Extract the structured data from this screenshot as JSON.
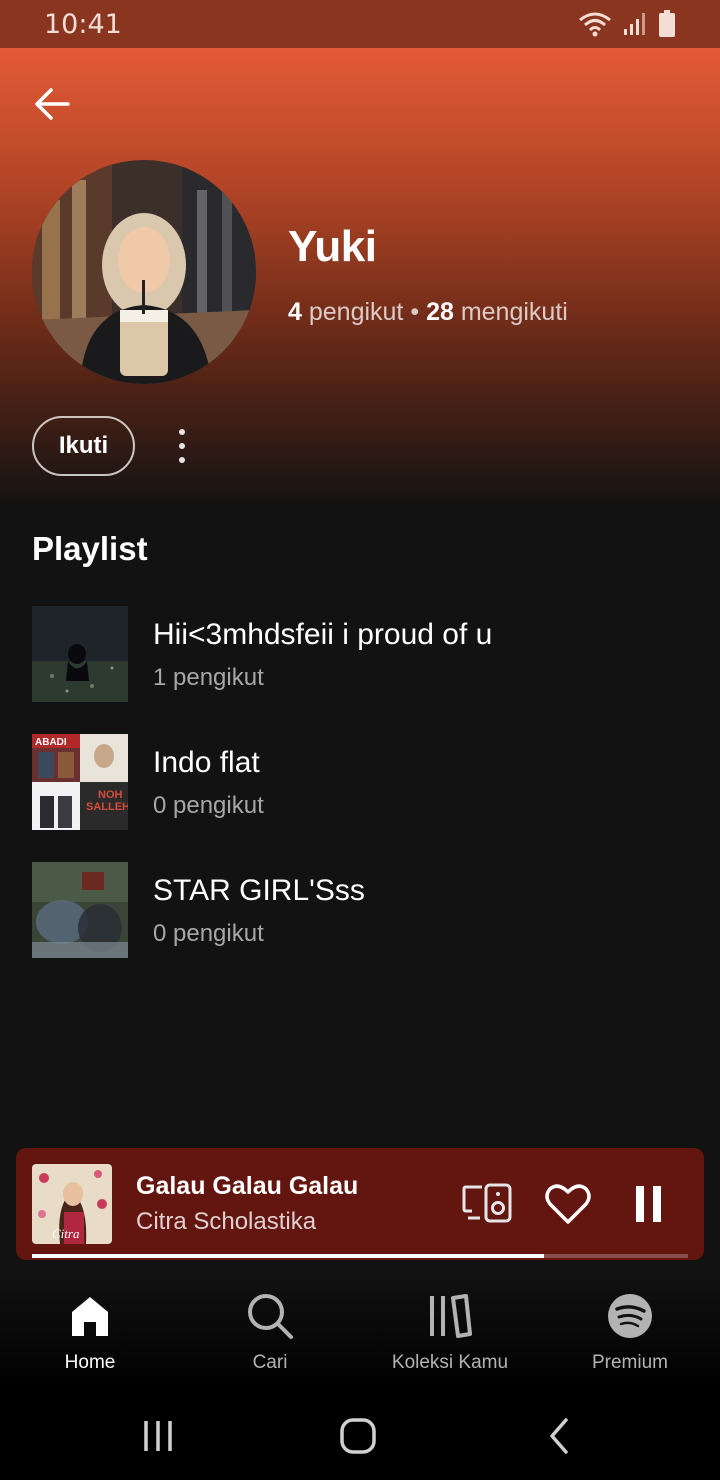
{
  "status_bar": {
    "time": "10:41"
  },
  "profile": {
    "name": "Yuki",
    "followers_count": "4",
    "followers_label": "pengikut",
    "separator": "•",
    "following_count": "28",
    "following_label": "mengikuti",
    "follow_label": "Ikuti"
  },
  "playlists_section": {
    "title": "Playlist",
    "items": [
      {
        "title": "Hii<3mhdsfeii i proud of u",
        "subtitle": "1 pengikut"
      },
      {
        "title": "Indo flat",
        "subtitle": "0 pengikut"
      },
      {
        "title": "STAR GIRL'Sss",
        "subtitle": "0 pengikut"
      }
    ]
  },
  "mini_player": {
    "title": "Galau Galau Galau",
    "artist": "Citra Scholastika",
    "progress_fraction": 0.78,
    "cover_text": "Citra"
  },
  "bottom_nav": {
    "items": [
      {
        "label": "Home",
        "icon": "home-icon",
        "active": true
      },
      {
        "label": "Cari",
        "icon": "search-icon",
        "active": false
      },
      {
        "label": "Koleksi Kamu",
        "icon": "library-icon",
        "active": false
      },
      {
        "label": "Premium",
        "icon": "spotify-icon",
        "active": false
      }
    ]
  },
  "colors": {
    "hero_top": "#e45a36",
    "background": "#121212",
    "mini_player_bg": "#63150f",
    "text_secondary": "#a7a7a7"
  },
  "cover_art_text": {
    "indo_flat_tl": "ABADI",
    "indo_flat_br": "NOH SALLEH"
  }
}
